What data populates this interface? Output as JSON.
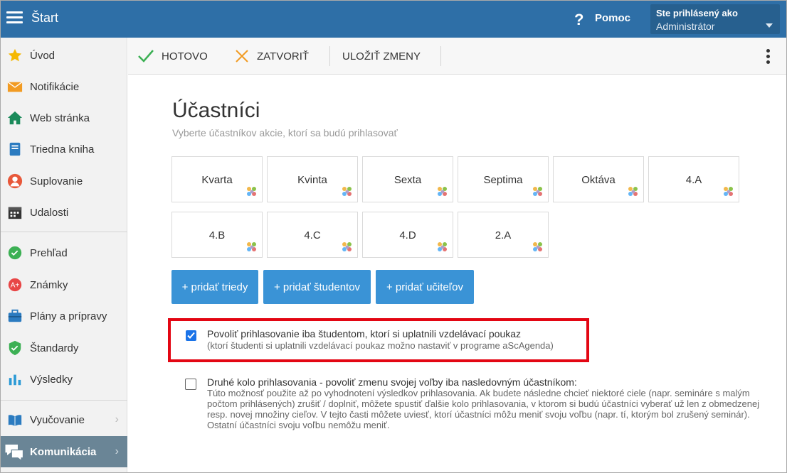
{
  "header": {
    "app_title": "Štart",
    "help_label": "Pomoc",
    "user_caption": "Ste prihlásený ako",
    "user_role": "Administrátor"
  },
  "sidebar": {
    "items": [
      {
        "label": "Úvod",
        "icon": "star-icon"
      },
      {
        "label": "Notifikácie",
        "icon": "envelope-icon"
      },
      {
        "label": "Web stránka",
        "icon": "home-icon"
      },
      {
        "label": "Triedna kniha",
        "icon": "notebook-icon"
      },
      {
        "label": "Suplovanie",
        "icon": "substitute-person-icon"
      },
      {
        "label": "Udalosti",
        "icon": "calendar-icon"
      },
      {
        "label": "Prehľad",
        "icon": "check-circle-icon"
      },
      {
        "label": "Známky",
        "icon": "grade-icon"
      },
      {
        "label": "Plány a prípravy",
        "icon": "briefcase-icon"
      },
      {
        "label": "Štandardy",
        "icon": "shield-check-icon"
      },
      {
        "label": "Výsledky",
        "icon": "bar-chart-icon"
      },
      {
        "label": "Vyučovanie",
        "icon": "book-icon"
      },
      {
        "label": "Komunikácia",
        "icon": "chat-icon"
      }
    ]
  },
  "toolbar": {
    "done_label": "HOTOVO",
    "close_label": "ZATVORIŤ",
    "save_label": "ULOŽIŤ ZMENY"
  },
  "main": {
    "title": "Účastníci",
    "subtitle": "Vyberte účastníkov akcie, ktorí sa budú prihlasovať",
    "participants": [
      "Kvarta",
      "Kvinta",
      "Sexta",
      "Septima",
      "Oktáva",
      "4.A",
      "4.B",
      "4.C",
      "4.D",
      "2.A"
    ],
    "add_classes_label": "+ pridať triedy",
    "add_students_label": "+ pridať študentov",
    "add_teachers_label": "+ pridať učiteľov",
    "option1": {
      "checked": true,
      "title": "Povoliť prihlasovanie iba študentom, ktorí si uplatnili vzdelávací poukaz",
      "description": "(ktorí študenti si uplatnili vzdelávací poukaz možno nastaviť v programe aScAgenda)"
    },
    "option2": {
      "checked": false,
      "title": "Druhé kolo prihlasovania - povoliť zmenu svojej voľby iba nasledovným účastníkom:",
      "description": "Túto možnosť použite až po vyhodnotení výsledkov prihlasovania. Ak budete následne chcieť niektoré ciele (napr. semináre s malým počtom prihlásených) zrušiť / doplniť, môžete spustiť ďalšie kolo prihlasovania, v ktorom si budú účastníci vyberať už len z obmedzenej resp. novej množiny cieľov. V tejto časti môžete uviesť, ktorí účastníci môžu meniť svoju voľbu (napr. tí, ktorým bol zrušený seminár). Ostatní účastníci svoju voľbu nemôžu meniť."
    }
  },
  "colors": {
    "header_bg": "#2e6fa7",
    "button_blue": "#3a93d6",
    "highlight_red": "#e30613",
    "active_sidebar": "#6a8596"
  }
}
